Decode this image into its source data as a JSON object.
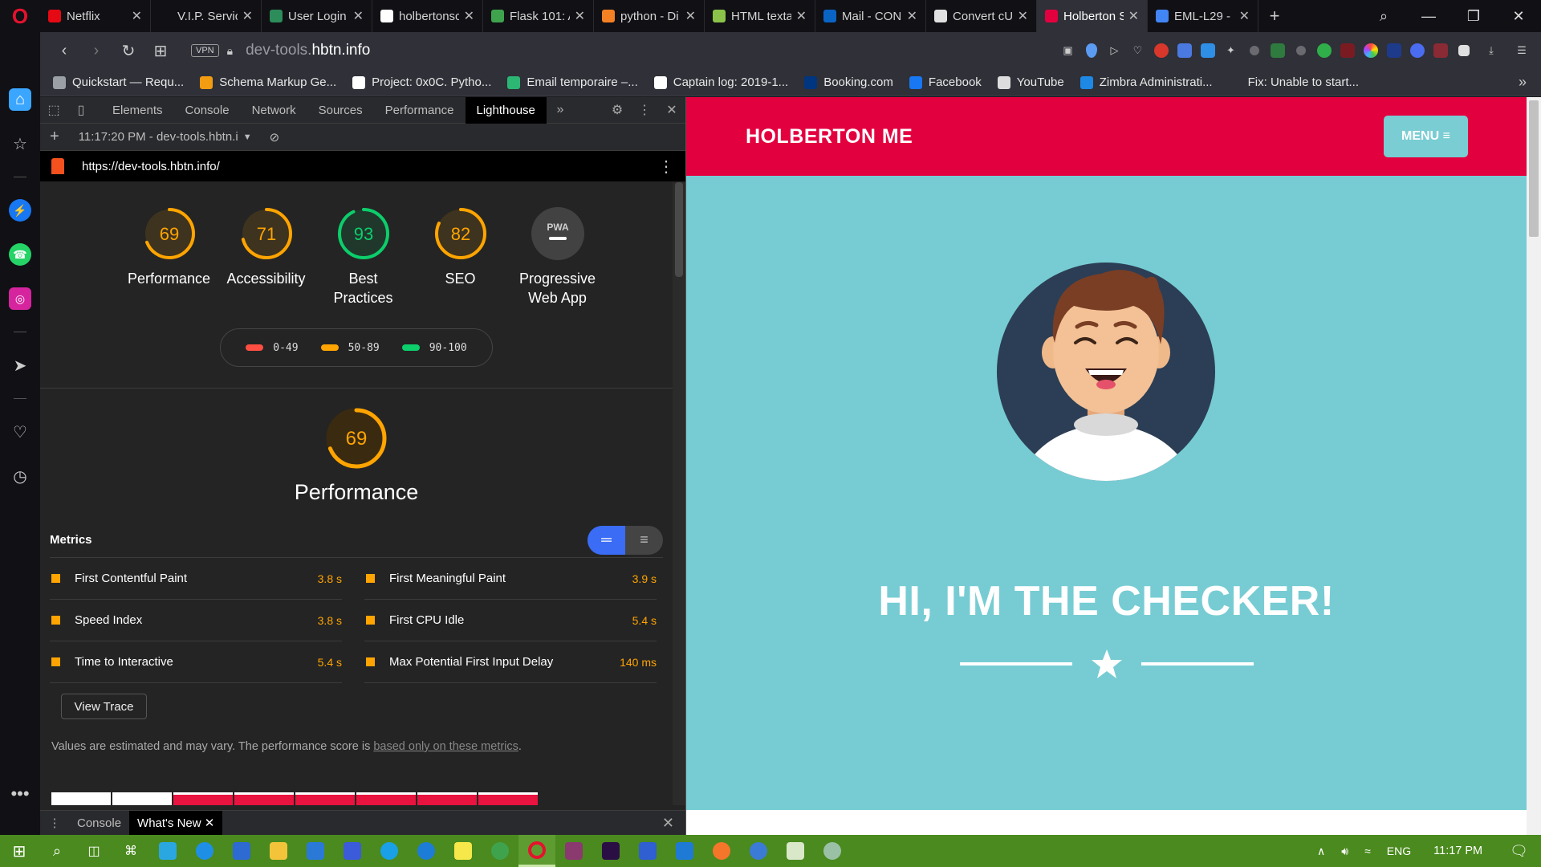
{
  "browser": {
    "tabs": [
      {
        "label": "Netflix",
        "icon_color": "#e50914",
        "icon": "netflix-icon"
      },
      {
        "label": "V.I.P. Servic",
        "icon_color": "#101015",
        "icon": "none"
      },
      {
        "label": "User Login |",
        "icon_color": "#2c8c5a",
        "icon": "user-login-icon"
      },
      {
        "label": "holbertonsc",
        "icon_color": "#ffffff",
        "icon": "github-icon"
      },
      {
        "label": "Flask 101: A",
        "icon_color": "#3fa34d",
        "icon": "flask-icon"
      },
      {
        "label": "python - Di",
        "icon_color": "#f48024",
        "icon": "stackoverflow-icon"
      },
      {
        "label": "HTML texta",
        "icon_color": "#8bc34a",
        "icon": "html-icon"
      },
      {
        "label": "Mail - CON",
        "icon_color": "#0a64c4",
        "icon": "outlook-icon"
      },
      {
        "label": "Convert cU",
        "icon_color": "#e0e0e0",
        "icon": "document-icon"
      },
      {
        "label": "Holberton S",
        "icon_color": "#e3003f",
        "icon": "holberton-icon",
        "active": true
      },
      {
        "label": "EML-L29 - (",
        "icon_color": "#4285f4",
        "icon": "google-icon"
      }
    ],
    "address": {
      "prefix": "dev-tools.",
      "domain": "hbtn.info",
      "vpn": "VPN"
    },
    "bookmarks": [
      {
        "label": "Quickstart — Requ...",
        "color": "#9aa0a6"
      },
      {
        "label": "Schema Markup Ge...",
        "color": "#f39c12"
      },
      {
        "label": "Project: 0x0C. Pytho...",
        "color": "#ffffff"
      },
      {
        "label": "Email temporaire –...",
        "color": "#2bb673"
      },
      {
        "label": "Captain log: 2019-1...",
        "color": "#ffffff"
      },
      {
        "label": "Booking.com",
        "color": "#003580"
      },
      {
        "label": "Facebook",
        "color": "#1877f2"
      },
      {
        "label": "YouTube",
        "color": "#dddddd"
      },
      {
        "label": "Zimbra Administrati...",
        "color": "#1e88e5"
      },
      {
        "label": "Fix: Unable to start...",
        "color": "#2f3038"
      }
    ]
  },
  "devtools": {
    "tabs": [
      "Elements",
      "Console",
      "Network",
      "Sources",
      "Performance",
      "Lighthouse"
    ],
    "active_tab": "Lighthouse",
    "report_selector": "11:17:20 PM - dev-tools.hbtn.i",
    "report_url": "https://dev-tools.hbtn.info/",
    "scores": [
      {
        "value": "69",
        "label": "Performance",
        "pct": 0.69,
        "color": "#ffa400"
      },
      {
        "value": "71",
        "label": "Accessibility",
        "pct": 0.71,
        "color": "#ffa400"
      },
      {
        "value": "93",
        "label": "Best Practices",
        "pct": 0.93,
        "color": "#0cce6b"
      },
      {
        "value": "82",
        "label": "SEO",
        "pct": 0.82,
        "color": "#ffa400"
      },
      {
        "value": "PWA",
        "label": "Progressive Web App",
        "pct": 0,
        "color": "#9e9e9e"
      }
    ],
    "legend": [
      {
        "range": "0-49",
        "color": "#ff4e42"
      },
      {
        "range": "50-89",
        "color": "#ffa400"
      },
      {
        "range": "90-100",
        "color": "#0cce6b"
      }
    ],
    "perf_score": "69",
    "perf_title": "Performance",
    "metrics_title": "Metrics",
    "metrics": [
      {
        "name": "First Contentful Paint",
        "value": "3.8 s"
      },
      {
        "name": "First Meaningful Paint",
        "value": "3.9 s"
      },
      {
        "name": "Speed Index",
        "value": "3.8 s"
      },
      {
        "name": "First CPU Idle",
        "value": "5.4 s"
      },
      {
        "name": "Time to Interactive",
        "value": "5.4 s"
      },
      {
        "name": "Max Potential First Input Delay",
        "value": "140 ms"
      }
    ],
    "view_trace": "View Trace",
    "note": "Values are estimated and may vary. The performance score is ",
    "note_link": "based only on these metrics",
    "note_end": ".",
    "drawer_tabs": [
      "Console",
      "What's New"
    ]
  },
  "page": {
    "brand": "HOLBERTON ME",
    "menu": "MENU",
    "headline": "HI, I'M THE CHECKER!"
  },
  "taskbar": {
    "lang": "ENG",
    "clock": "11:17 PM"
  }
}
